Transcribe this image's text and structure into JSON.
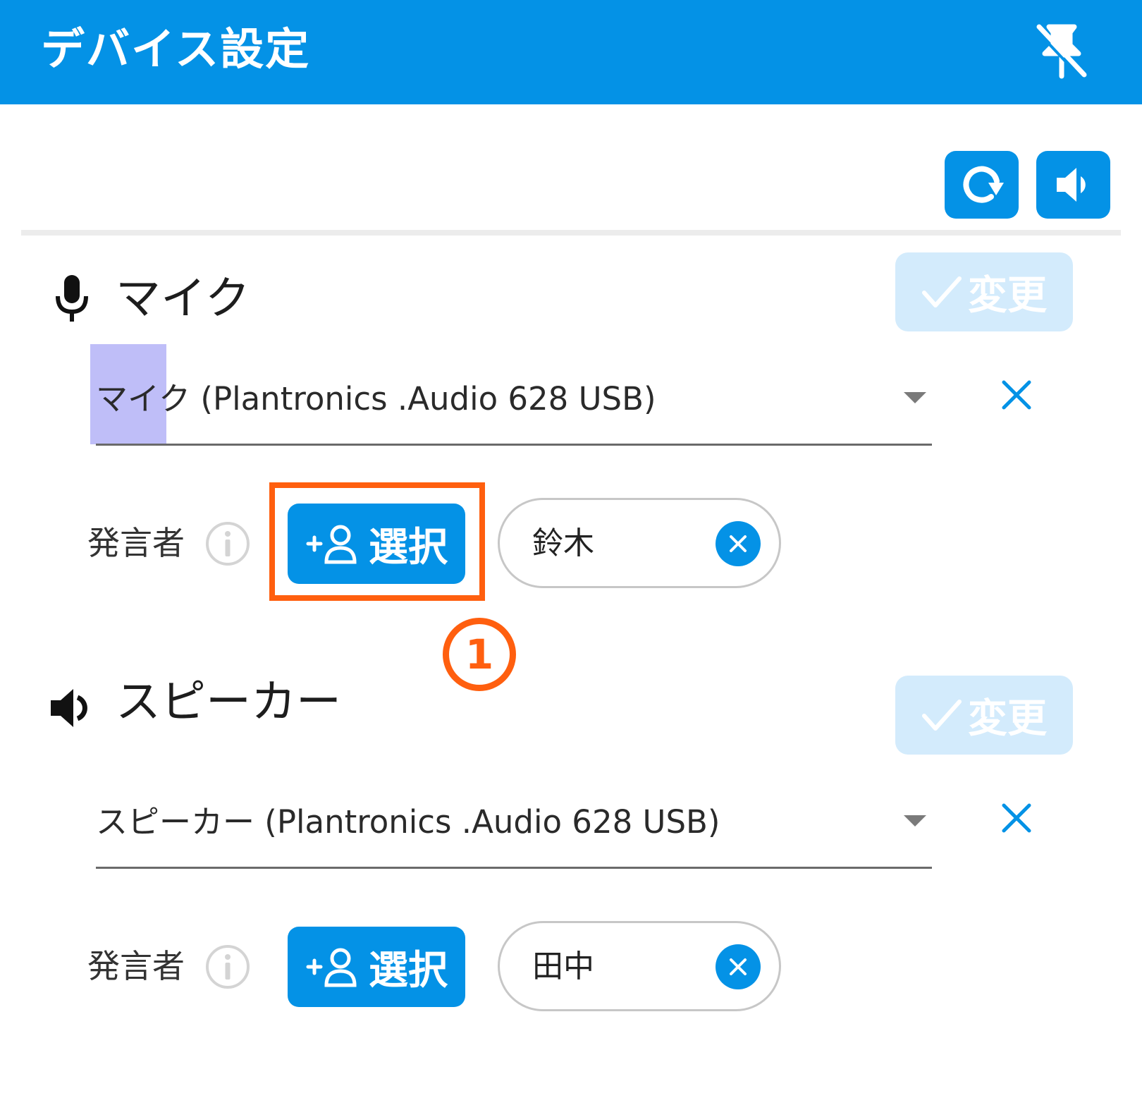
{
  "header": {
    "title": "デバイス設定",
    "pin_icon": "pin-off-icon"
  },
  "toolbar": {
    "refresh_icon": "refresh-icon",
    "sound_test_icon": "speaker-icon"
  },
  "mic": {
    "title": "マイク",
    "icon": "microphone-icon",
    "change_label": "変更",
    "device": "マイク (Plantronics .Audio 628 USB)",
    "speaker_label": "発言者",
    "select_label": "選択",
    "speaker_name": "鈴木"
  },
  "speaker": {
    "title": "スピーカー",
    "icon": "speaker-icon",
    "change_label": "変更",
    "device": "スピーカー (Plantronics .Audio 628 USB)",
    "speaker_label": "発言者",
    "select_label": "選択",
    "speaker_name": "田中"
  },
  "annotation": {
    "step_number": "1"
  },
  "colors": {
    "accent": "#0492e6",
    "callout": "#ff5f0f",
    "disabled_button": "#d3ebfc",
    "highlight": "#bfbef8"
  }
}
